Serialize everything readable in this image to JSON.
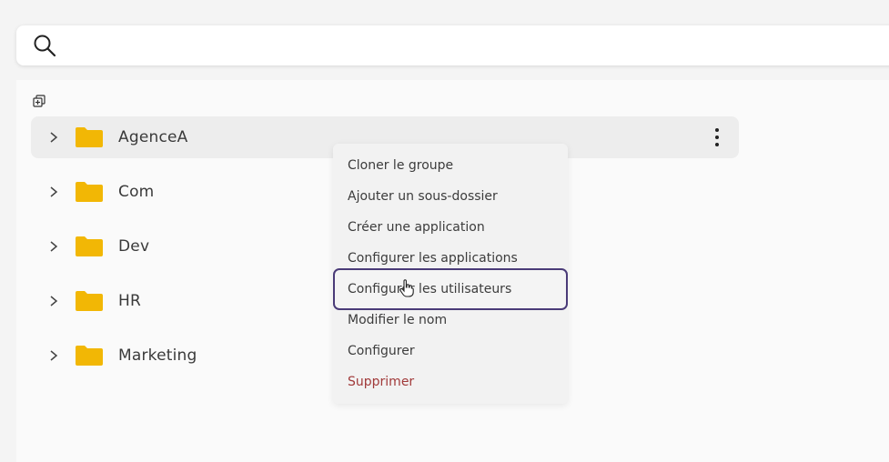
{
  "search": {
    "value": "",
    "placeholder": ""
  },
  "tree": [
    {
      "label": "AgenceA",
      "selected": true
    },
    {
      "label": "Com"
    },
    {
      "label": "Dev"
    },
    {
      "label": "HR"
    },
    {
      "label": "Marketing"
    }
  ],
  "context_menu": {
    "items": [
      {
        "label": "Cloner le groupe"
      },
      {
        "label": "Ajouter un sous-dossier"
      },
      {
        "label": "Créer une application"
      },
      {
        "label": "Configurer les applications"
      },
      {
        "label": "Configurer les utilisateurs",
        "hovered": true
      },
      {
        "label": "Modifier le nom"
      },
      {
        "label": "Configurer"
      },
      {
        "label": "Supprimer",
        "danger": true
      }
    ]
  },
  "colors": {
    "folder": "#f2b705",
    "highlight_border": "#4a3b78",
    "danger": "#a13a3a"
  }
}
